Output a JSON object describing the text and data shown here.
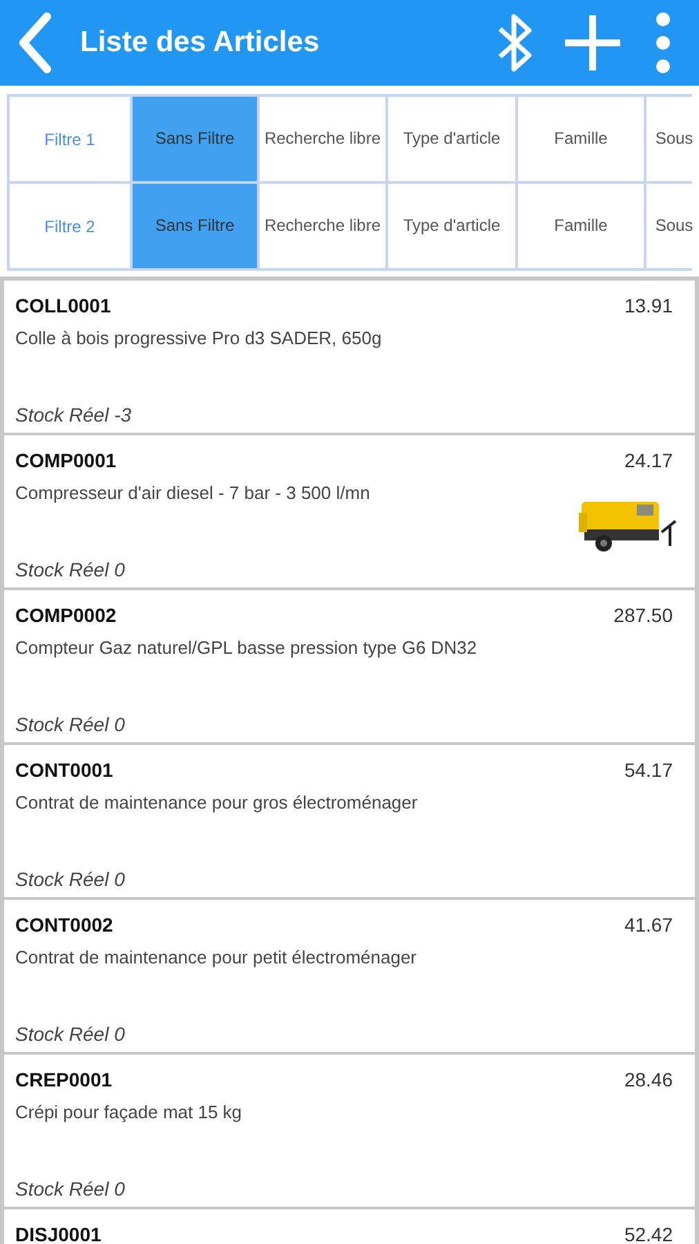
{
  "app_bar": {
    "title": "Liste des Articles"
  },
  "filters": [
    {
      "label": "Filtre 1",
      "options": [
        {
          "text": "Sans Filtre",
          "selected": true
        },
        {
          "text": "Recherche libre",
          "selected": false
        },
        {
          "text": "Type d'article",
          "selected": false
        },
        {
          "text": "Famille",
          "selected": false
        },
        {
          "text": "Sous",
          "selected": false
        }
      ]
    },
    {
      "label": "Filtre 2",
      "options": [
        {
          "text": "Sans Filtre",
          "selected": true
        },
        {
          "text": "Recherche libre",
          "selected": false
        },
        {
          "text": "Type d'article",
          "selected": false
        },
        {
          "text": "Famille",
          "selected": false
        },
        {
          "text": "Sous",
          "selected": false
        }
      ]
    }
  ],
  "articles": [
    {
      "code": "COLL0001",
      "price": "13.91",
      "description": "Colle à bois progressive Pro d3 SADER, 650g",
      "stock": "Stock Réel -3"
    },
    {
      "code": "COMP0001",
      "price": "24.17",
      "description": "Compresseur d'air diesel - 7 bar - 3 500 l/mn",
      "stock": "Stock Réel 0"
    },
    {
      "code": "COMP0002",
      "price": "287.50",
      "description": "Compteur Gaz naturel/GPL basse pression type G6 DN32",
      "stock": "Stock Réel 0"
    },
    {
      "code": "CONT0001",
      "price": "54.17",
      "description": "Contrat de maintenance pour gros électroménager",
      "stock": "Stock Réel 0"
    },
    {
      "code": "CONT0002",
      "price": "41.67",
      "description": "Contrat de maintenance pour petit électroménager",
      "stock": "Stock Réel 0"
    },
    {
      "code": "CREP0001",
      "price": "28.46",
      "description": "Crépi pour façade mat 15 kg",
      "stock": "Stock Réel 0"
    },
    {
      "code": "DISJ0001",
      "price": "52.42"
    }
  ]
}
